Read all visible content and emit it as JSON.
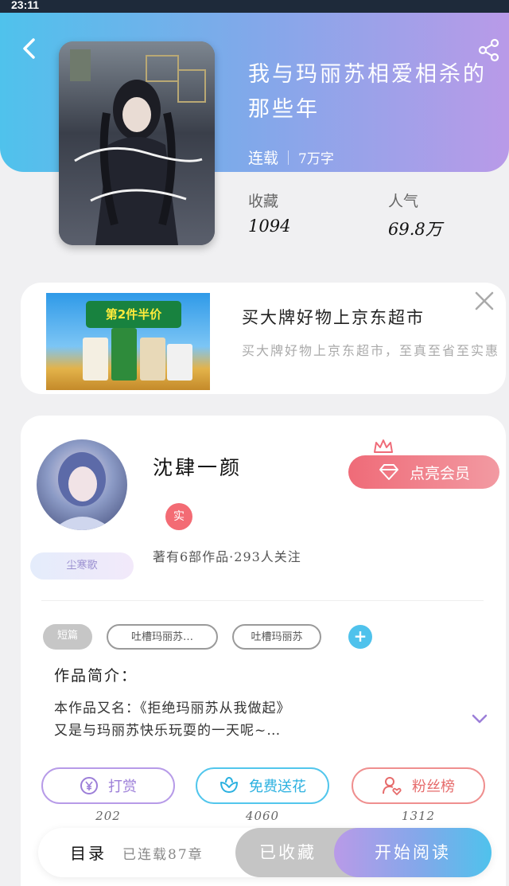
{
  "status": {
    "time": "23:11"
  },
  "book": {
    "title": "我与玛丽苏相爱相杀的那些年",
    "status": "连载",
    "words": "7万字",
    "stats": [
      {
        "label": "收藏",
        "value": "1094"
      },
      {
        "label": "人气",
        "value": "69.8万"
      }
    ]
  },
  "ad": {
    "banner_text": "第2件半价",
    "title": "买大牌好物上京东超市",
    "desc": "买大牌好物上京东超市，至真至省至实惠"
  },
  "author": {
    "name": "沈肆一颜",
    "real_badge": "实",
    "vip_button": "点亮会员",
    "badge_text": "尘寒歌",
    "works_info": "著有6部作品·293人关注"
  },
  "tags": [
    "短篇",
    "吐槽玛丽苏…",
    "吐槽玛丽苏",
    "+"
  ],
  "intro": {
    "heading": "作品简介：",
    "line1": "本作品又名：《拒绝玛丽苏从我做起》",
    "line2": "又是与玛丽苏快乐玩耍的一天呢~…"
  },
  "actions": [
    {
      "label": "打赏",
      "count": "202",
      "color": "#9c7ed8"
    },
    {
      "label": "免费送花",
      "count": "4060",
      "color": "#2cb1e0"
    },
    {
      "label": "粉丝榜",
      "count": "1312",
      "color": "#e66b6b"
    }
  ],
  "bottom": {
    "toc_label": "目录",
    "toc_sub": "已连载87章",
    "favorited_label": "已收藏",
    "read_label": "开始阅读"
  }
}
